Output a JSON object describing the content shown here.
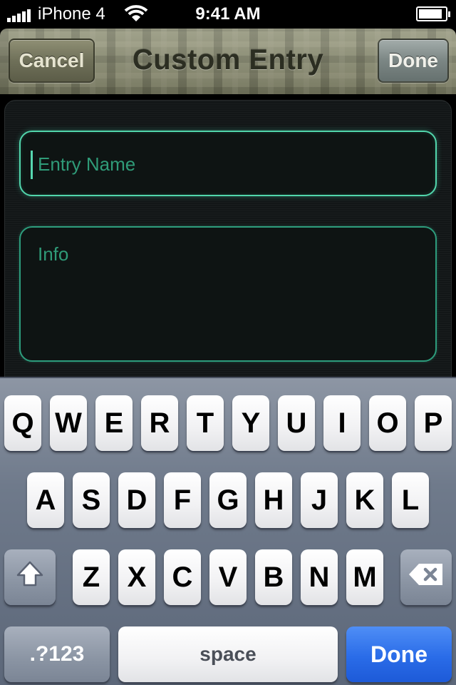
{
  "status_bar": {
    "carrier": "iPhone 4",
    "time": "9:41 AM",
    "signal_bars": 5,
    "battery_level": 0.9
  },
  "nav": {
    "title": "Custom Entry",
    "cancel_label": "Cancel",
    "done_label": "Done"
  },
  "form": {
    "entry_name": {
      "value": "",
      "placeholder": "Entry Name"
    },
    "info": {
      "value": "",
      "placeholder": "Info"
    }
  },
  "keyboard": {
    "row1": [
      "Q",
      "W",
      "E",
      "R",
      "T",
      "Y",
      "U",
      "I",
      "O",
      "P"
    ],
    "row2": [
      "A",
      "S",
      "D",
      "F",
      "G",
      "H",
      "J",
      "K",
      "L"
    ],
    "row3": [
      "Z",
      "X",
      "C",
      "V",
      "B",
      "N",
      "M"
    ],
    "numbers_label": ".?123",
    "space_label": "space",
    "return_label": "Done",
    "shift_icon": "shift-arrow-icon",
    "delete_icon": "backspace-icon"
  },
  "colors": {
    "accent_green": "#3bb894",
    "return_blue": "#2a6ce8"
  }
}
